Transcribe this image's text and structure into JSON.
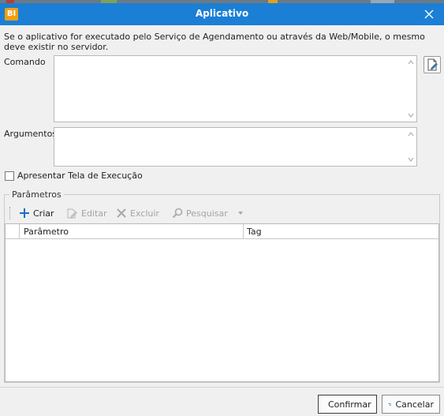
{
  "window": {
    "app_badge": "BI",
    "title": "Aplicativo"
  },
  "info_text": "Se o aplicativo for executado pelo Serviço de Agendamento ou através da Web/Mobile, o mesmo deve existir no servidor.",
  "fields": {
    "comando_label": "Comando",
    "comando_value": "",
    "argumentos_label": "Argumentos",
    "argumentos_value": ""
  },
  "checkbox": {
    "label": "Apresentar Tela de Execução",
    "checked": false
  },
  "parametros": {
    "group_title": "Parâmetros",
    "toolbar": {
      "criar": "Criar",
      "editar": "Editar",
      "excluir": "Excluir",
      "pesquisar": "Pesquisar"
    },
    "columns": [
      "Parâmetro",
      "Tag"
    ],
    "rows": []
  },
  "buttons": {
    "confirmar": "Confirmar",
    "cancelar": "Cancelar"
  },
  "colors": {
    "titlebar": "#1b7fd5",
    "badge": "#f0a013",
    "confirm_check": "#2e9e4a",
    "criar_plus": "#1b6fc2"
  }
}
